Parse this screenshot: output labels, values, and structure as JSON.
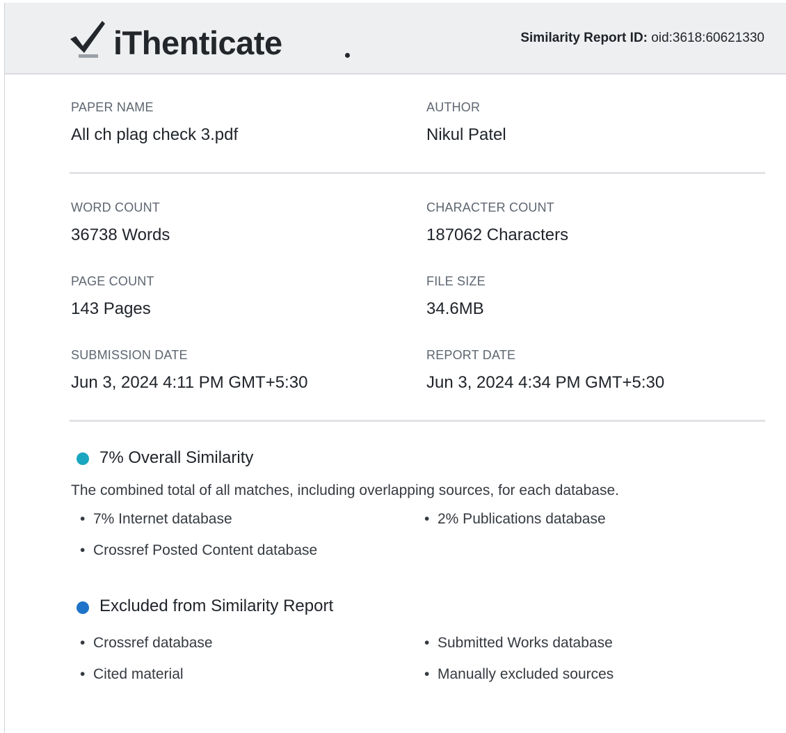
{
  "header": {
    "brand_name": "iThenticate",
    "report_id_label": "Similarity Report ID:",
    "report_id_value": "oid:3618:60621330"
  },
  "paper": {
    "paper_name_label": "PAPER NAME",
    "paper_name": "All ch plag check 3.pdf",
    "author_label": "AUTHOR",
    "author": "Nikul Patel"
  },
  "stats": {
    "word_count_label": "WORD COUNT",
    "word_count": "36738 Words",
    "character_count_label": "CHARACTER COUNT",
    "character_count": "187062 Characters",
    "page_count_label": "PAGE COUNT",
    "page_count": "143 Pages",
    "file_size_label": "FILE SIZE",
    "file_size": "34.6MB",
    "submission_date_label": "SUBMISSION DATE",
    "submission_date": "Jun 3, 2024 4:11 PM GMT+5:30",
    "report_date_label": "REPORT DATE",
    "report_date": "Jun 3, 2024 4:34 PM GMT+5:30"
  },
  "similarity": {
    "title": "7% Overall Similarity",
    "description": "The combined total of all matches, including overlapping sources, for each database.",
    "items": [
      "7% Internet database",
      "2% Publications database",
      "Crossref Posted Content database"
    ]
  },
  "excluded": {
    "title": "Excluded from Similarity Report",
    "items": [
      "Crossref database",
      "Submitted Works database",
      "Cited material",
      "Manually excluded sources"
    ]
  },
  "colors": {
    "similarity_dot": "#1aa6c0",
    "excluded_dot": "#1f73c9",
    "header_bg": "#eeeff1"
  },
  "icons": {
    "logo": "checkmark-icon",
    "bullet": "bullet-dot"
  }
}
